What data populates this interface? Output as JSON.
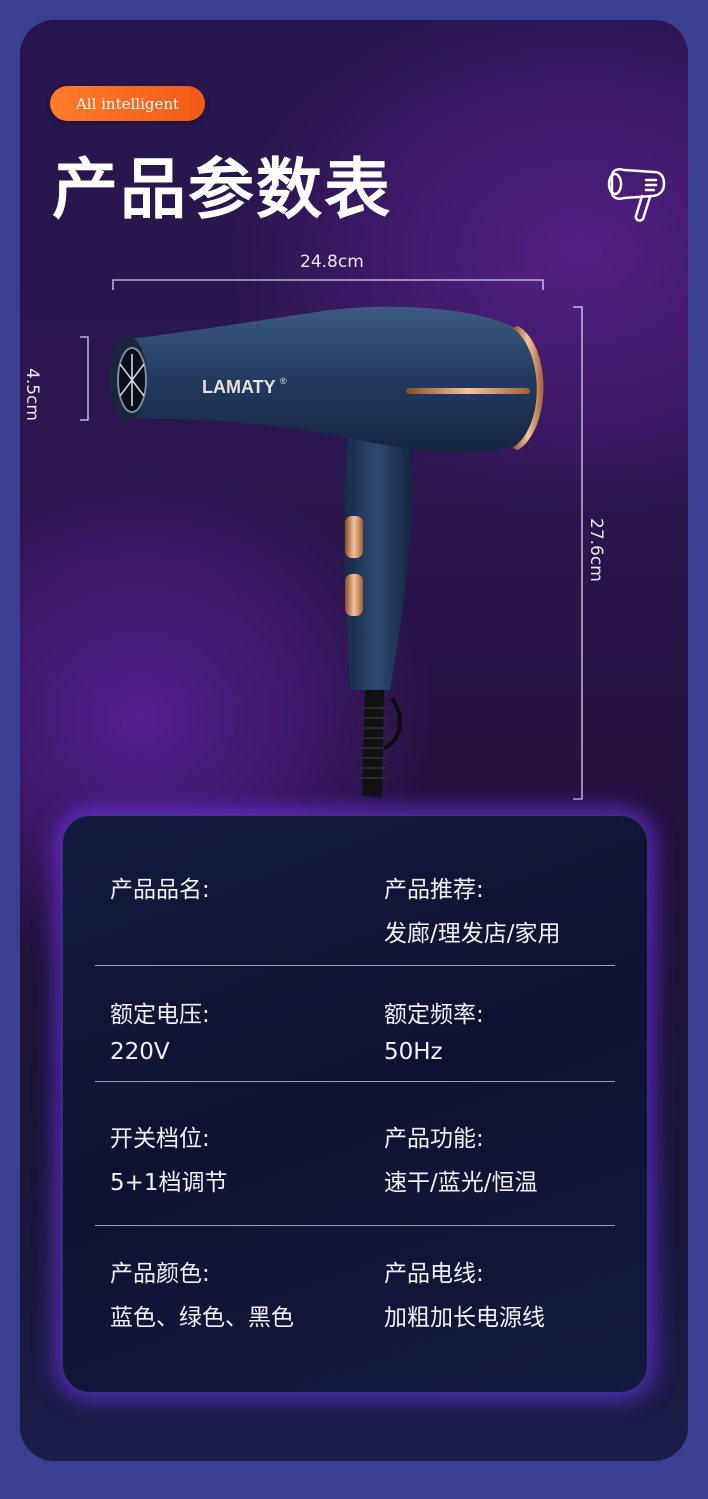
{
  "badge": {
    "text": "All intelligent"
  },
  "title": "产品参数表",
  "dimensions": {
    "width": "24.8cm",
    "nozzle": "4.5cm",
    "height": "27.6cm"
  },
  "brand": {
    "logo_text": "LAMATY",
    "registered_mark": "®"
  },
  "specs": {
    "product_name_label": "产品品名:",
    "product_name_value": "",
    "recommend_label": "产品推荐:",
    "recommend_value": "发廊/理发店/家用",
    "voltage_label": "额定电压:",
    "voltage_value": "220V",
    "frequency_label": "额定频率:",
    "frequency_value": "50Hz",
    "gear_label": "开关档位:",
    "gear_value": "5+1档调节",
    "function_label": "产品功能:",
    "function_value": "速干/蓝光/恒温",
    "color_label": "产品颜色:",
    "color_value": "蓝色、绿色、黑色",
    "cable_label": "产品电线:",
    "cable_value": "加粗加长电源线"
  },
  "colors": {
    "page_bg": "#3b3f91",
    "badge": "#f5661d",
    "panel_glow": "#7a37ff",
    "dryer_body": "#233a5e",
    "accent_gold": "#d8996a"
  },
  "icons": {
    "top_right": "hair-dryer-icon"
  }
}
